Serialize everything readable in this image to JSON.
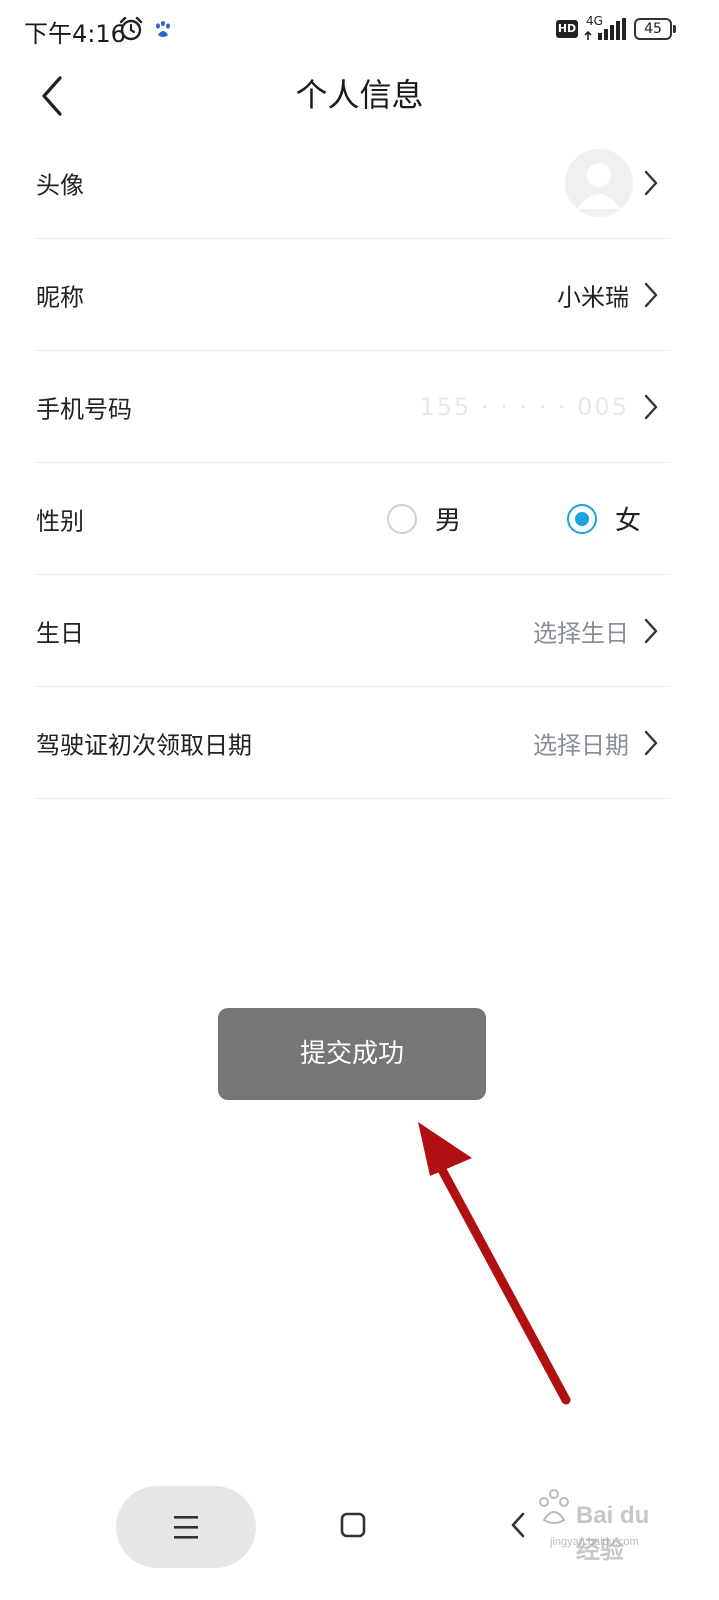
{
  "status_bar": {
    "time": "下午4:16",
    "network": "4G",
    "battery": "45"
  },
  "header": {
    "title": "个人信息"
  },
  "rows": {
    "avatar": {
      "label": "头像"
    },
    "nickname": {
      "label": "昵称",
      "value": "小米瑞"
    },
    "phone": {
      "label": "手机号码",
      "value": "155 · · · · · 005"
    },
    "gender": {
      "label": "性别",
      "options": [
        "男",
        "女"
      ],
      "selected": "女"
    },
    "birthday": {
      "label": "生日",
      "placeholder": "选择生日"
    },
    "license_date": {
      "label": "驾驶证初次领取日期",
      "placeholder": "选择日期"
    }
  },
  "toast": {
    "message": "提交成功"
  },
  "watermark": {
    "text": "Bai du 经验",
    "sub": "jingyan.baidu.com"
  },
  "colors": {
    "accent": "#1aa3dc",
    "toast_bg": "#767676",
    "arrow": "#b01010",
    "placeholder": "#8a8f99"
  }
}
